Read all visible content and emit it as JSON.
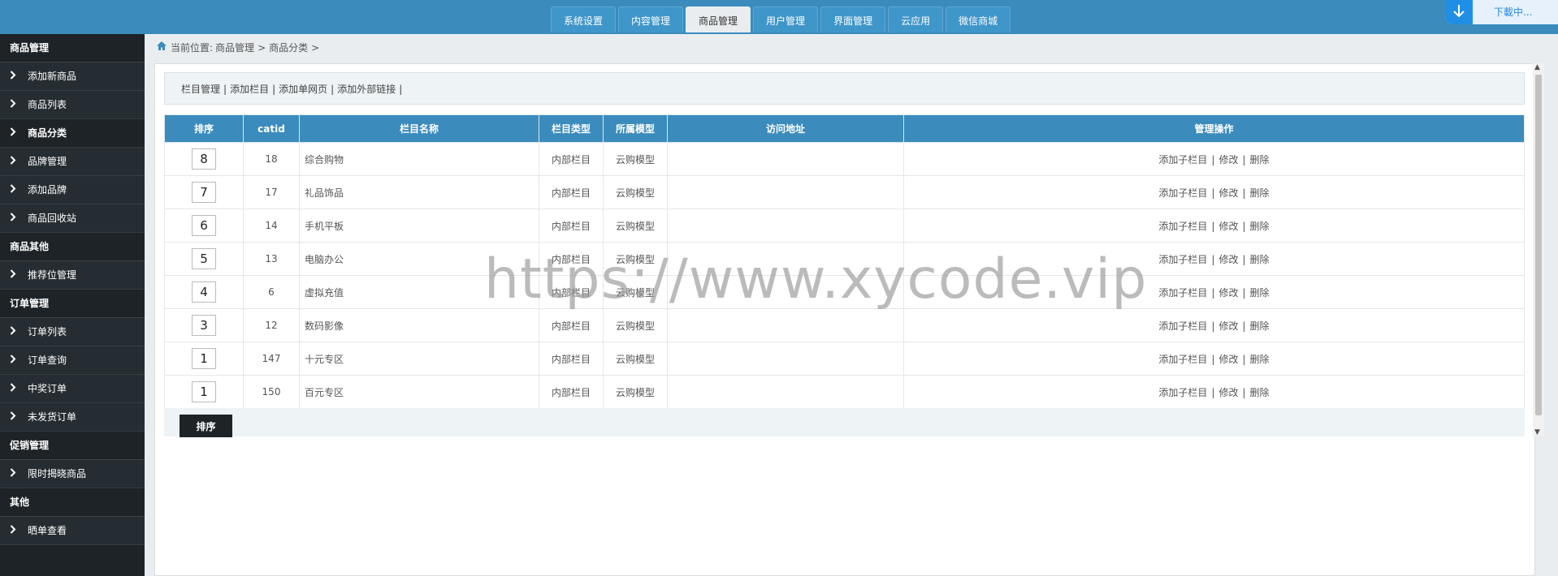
{
  "top_tabs": [
    {
      "label": "系统设置",
      "active": false
    },
    {
      "label": "内容管理",
      "active": false
    },
    {
      "label": "商品管理",
      "active": true
    },
    {
      "label": "用户管理",
      "active": false
    },
    {
      "label": "界面管理",
      "active": false
    },
    {
      "label": "云应用",
      "active": false
    },
    {
      "label": "微信商城",
      "active": false
    }
  ],
  "download": {
    "label": "下載中..."
  },
  "sidebar": {
    "sections": [
      {
        "title": "商品管理",
        "items": [
          {
            "label": "添加新商品"
          },
          {
            "label": "商品列表"
          },
          {
            "label": "商品分类",
            "active": true
          },
          {
            "label": "品牌管理"
          },
          {
            "label": "添加品牌"
          },
          {
            "label": "商品回收站"
          }
        ]
      },
      {
        "title": "商品其他",
        "items": [
          {
            "label": "推荐位管理"
          }
        ]
      },
      {
        "title": "订单管理",
        "items": [
          {
            "label": "订单列表"
          },
          {
            "label": "订单查询"
          },
          {
            "label": "中奖订单"
          },
          {
            "label": "未发货订单"
          }
        ]
      },
      {
        "title": "促销管理",
        "items": [
          {
            "label": "限时揭晓商品"
          }
        ]
      },
      {
        "title": "其他",
        "items": [
          {
            "label": "晒单查看"
          }
        ]
      }
    ]
  },
  "breadcrumb": {
    "prefix": "当前位置:",
    "path1": "商品管理",
    "sep": ">",
    "path2": "商品分类",
    "tail": ">"
  },
  "subnav": [
    "栏目管理",
    "添加栏目",
    "添加单网页",
    "添加外部链接"
  ],
  "table": {
    "headers": [
      "排序",
      "catid",
      "栏目名称",
      "栏目类型",
      "所属模型",
      "访问地址",
      "管理操作"
    ],
    "rows": [
      {
        "order": "8",
        "catid": "18",
        "name": "综合购物",
        "type": "内部栏目",
        "model": "云购模型",
        "url": ""
      },
      {
        "order": "7",
        "catid": "17",
        "name": "礼品饰品",
        "type": "内部栏目",
        "model": "云购模型",
        "url": ""
      },
      {
        "order": "6",
        "catid": "14",
        "name": "手机平板",
        "type": "内部栏目",
        "model": "云购模型",
        "url": ""
      },
      {
        "order": "5",
        "catid": "13",
        "name": "电脑办公",
        "type": "内部栏目",
        "model": "云购模型",
        "url": ""
      },
      {
        "order": "4",
        "catid": "6",
        "name": "虚拟充值",
        "type": "内部栏目",
        "model": "云购模型",
        "url": ""
      },
      {
        "order": "3",
        "catid": "12",
        "name": "数码影像",
        "type": "内部栏目",
        "model": "云购模型",
        "url": ""
      },
      {
        "order": "1",
        "catid": "147",
        "name": "十元专区",
        "type": "内部栏目",
        "model": "云购模型",
        "url": ""
      },
      {
        "order": "1",
        "catid": "150",
        "name": "百元专区",
        "type": "内部栏目",
        "model": "云购模型",
        "url": ""
      }
    ],
    "ops": {
      "add_child": "添加子栏目",
      "edit": "修改",
      "delete": "删除",
      "sep": "|"
    }
  },
  "sort_button": "排序",
  "watermark": "https://www.xycode.vip"
}
